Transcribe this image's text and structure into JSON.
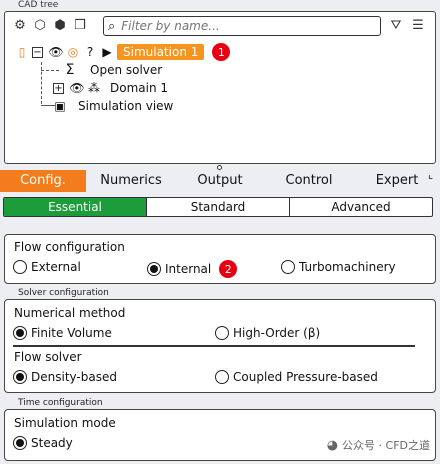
{
  "cad_tree": {
    "label": "CAD tree",
    "search_placeholder": "Filter by name...",
    "root": {
      "label": "Simulation 1",
      "marker": "1"
    },
    "children": [
      {
        "label": "Open solver"
      },
      {
        "label": "Domain 1"
      },
      {
        "label": "Simulation view"
      }
    ]
  },
  "tabs": [
    "Config.",
    "Numerics",
    "Output",
    "Control",
    "Expert"
  ],
  "subtabs": [
    "Essential",
    "Standard",
    "Advanced"
  ],
  "flow_configuration": {
    "title": "Flow configuration",
    "options": [
      "External",
      "Internal",
      "Turbomachinery"
    ],
    "selected": "Internal",
    "marker": "2"
  },
  "solver_configuration": {
    "section_label": "Solver configuration",
    "numerical_method": {
      "title": "Numerical method",
      "options": [
        "Finite Volume",
        "High-Order (β)"
      ],
      "selected": "Finite Volume"
    },
    "flow_solver": {
      "title": "Flow solver",
      "options": [
        "Density-based",
        "Coupled Pressure-based"
      ],
      "selected": "Density-based"
    }
  },
  "time_configuration": {
    "section_label": "Time configuration",
    "simulation_mode": {
      "title": "Simulation mode",
      "options": [
        "Steady"
      ],
      "selected": "Steady"
    }
  },
  "watermark": "公众号 · CFD之道",
  "colors": {
    "accent_orange": "#f37d1c",
    "active_green": "#1c9c3a",
    "marker_red": "#e60012"
  }
}
